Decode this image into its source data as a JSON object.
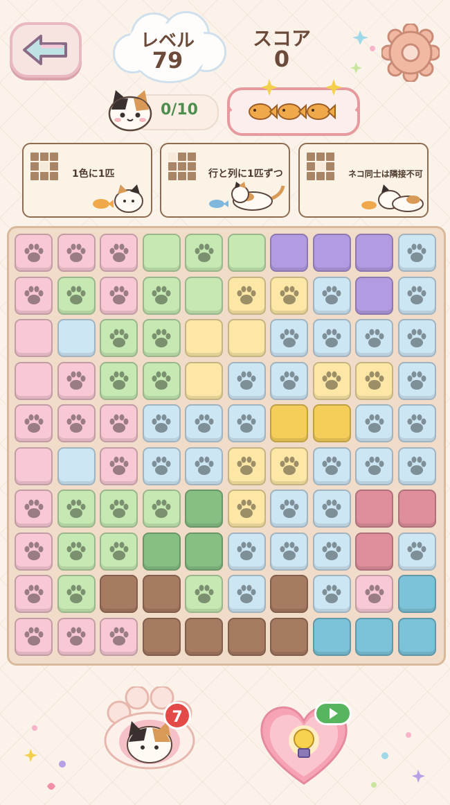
{
  "header": {
    "back_icon": "back-arrow-icon",
    "level_label": "レベル",
    "level_value": "79",
    "score_label": "スコア",
    "score_value": "0",
    "settings_icon": "gear-icon"
  },
  "progress": {
    "cats_text": "0/10",
    "fish_count": 3,
    "fish_icon": "taiyaki-fish-icon"
  },
  "rules": [
    {
      "text": "1色に1匹"
    },
    {
      "text": "行と列に1匹ずつ"
    },
    {
      "text": "ネコ同士は隣接不可"
    }
  ],
  "colors": {
    "pink": "#f8c8d4",
    "green": "#c6e8b2",
    "purple": "#b39be2",
    "blue": "#cde6f4",
    "yellow": "#fce7a6",
    "gold": "#f4cd5a",
    "darkgreen": "#86bf84",
    "rose": "#df8f9c",
    "brown": "#a77a62",
    "teal": "#7cc3d9"
  },
  "board": {
    "rows": [
      [
        "pink:paw",
        "pink:paw",
        "pink:paw",
        "green:plain",
        "green:paw",
        "green:plain",
        "purple:plain",
        "purple:plain",
        "purple:plain",
        "blue:paw"
      ],
      [
        "pink:paw",
        "green:paw",
        "pink:paw",
        "green:paw",
        "green:plain",
        "yellow:paw",
        "yellow:paw",
        "blue:paw",
        "purple:plain",
        "blue:paw"
      ],
      [
        "pink:plain",
        "blue:plain",
        "green:paw",
        "green:paw",
        "yellow:plain",
        "yellow:plain",
        "blue:paw",
        "blue:paw",
        "blue:paw",
        "blue:paw"
      ],
      [
        "pink:plain",
        "pink:paw",
        "green:paw",
        "green:paw",
        "yellow:plain",
        "blue:paw",
        "blue:paw",
        "yellow:paw",
        "yellow:paw",
        "blue:paw"
      ],
      [
        "pink:paw",
        "pink:paw",
        "pink:paw",
        "blue:paw",
        "blue:paw",
        "blue:paw",
        "gold:plain",
        "gold:plain",
        "blue:paw",
        "blue:paw"
      ],
      [
        "pink:plain",
        "blue:plain",
        "pink:paw",
        "blue:paw",
        "blue:paw",
        "yellow:paw",
        "yellow:paw",
        "blue:paw",
        "blue:paw",
        "blue:paw"
      ],
      [
        "pink:paw",
        "green:paw",
        "green:paw",
        "green:paw",
        "darkgreen:plain",
        "yellow:paw",
        "blue:paw",
        "blue:paw",
        "rose:plain",
        "rose:plain"
      ],
      [
        "pink:paw",
        "green:paw",
        "green:paw",
        "darkgreen:plain",
        "darkgreen:plain",
        "blue:paw",
        "blue:paw",
        "blue:paw",
        "rose:plain",
        "blue:paw"
      ],
      [
        "pink:paw",
        "green:paw",
        "brown:plain",
        "brown:plain",
        "green:paw",
        "blue:paw",
        "brown:plain",
        "blue:paw",
        "pink:paw",
        "teal:plain"
      ],
      [
        "pink:paw",
        "pink:paw",
        "pink:paw",
        "brown:plain",
        "brown:plain",
        "brown:plain",
        "brown:plain",
        "teal:plain",
        "teal:plain",
        "teal:plain"
      ]
    ]
  },
  "bottom": {
    "cat_button_icon": "calico-cat-paw-icon",
    "cat_badge": "7",
    "hint_icon": "lightbulb-heart-icon",
    "play_icon": "play-icon"
  }
}
